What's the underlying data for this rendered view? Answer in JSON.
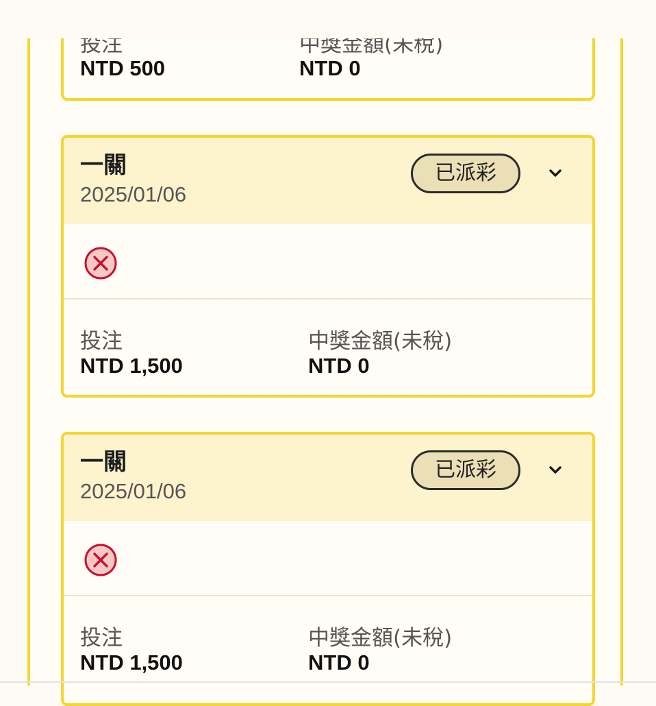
{
  "colors": {
    "accent_border": "#f7d531",
    "header_bg": "#fdf3cc",
    "badge_bg": "#ebdfb6",
    "lose_icon": "#c8102e"
  },
  "cards": [
    {
      "bet_label": "投注",
      "bet_value": "NTD 500",
      "prize_label": "中獎金額(未稅)",
      "prize_value": "NTD 0"
    },
    {
      "title": "一關",
      "date": "2025/01/06",
      "status": "已派彩",
      "result_icon": "close-circle-icon",
      "bet_label": "投注",
      "bet_value": "NTD 1,500",
      "prize_label": "中獎金額(未稅)",
      "prize_value": "NTD 0"
    },
    {
      "title": "一關",
      "date": "2025/01/06",
      "status": "已派彩",
      "result_icon": "close-circle-icon",
      "bet_label": "投注",
      "bet_value": "NTD 1,500",
      "prize_label": "中獎金額(未稅)",
      "prize_value": "NTD 0"
    }
  ]
}
